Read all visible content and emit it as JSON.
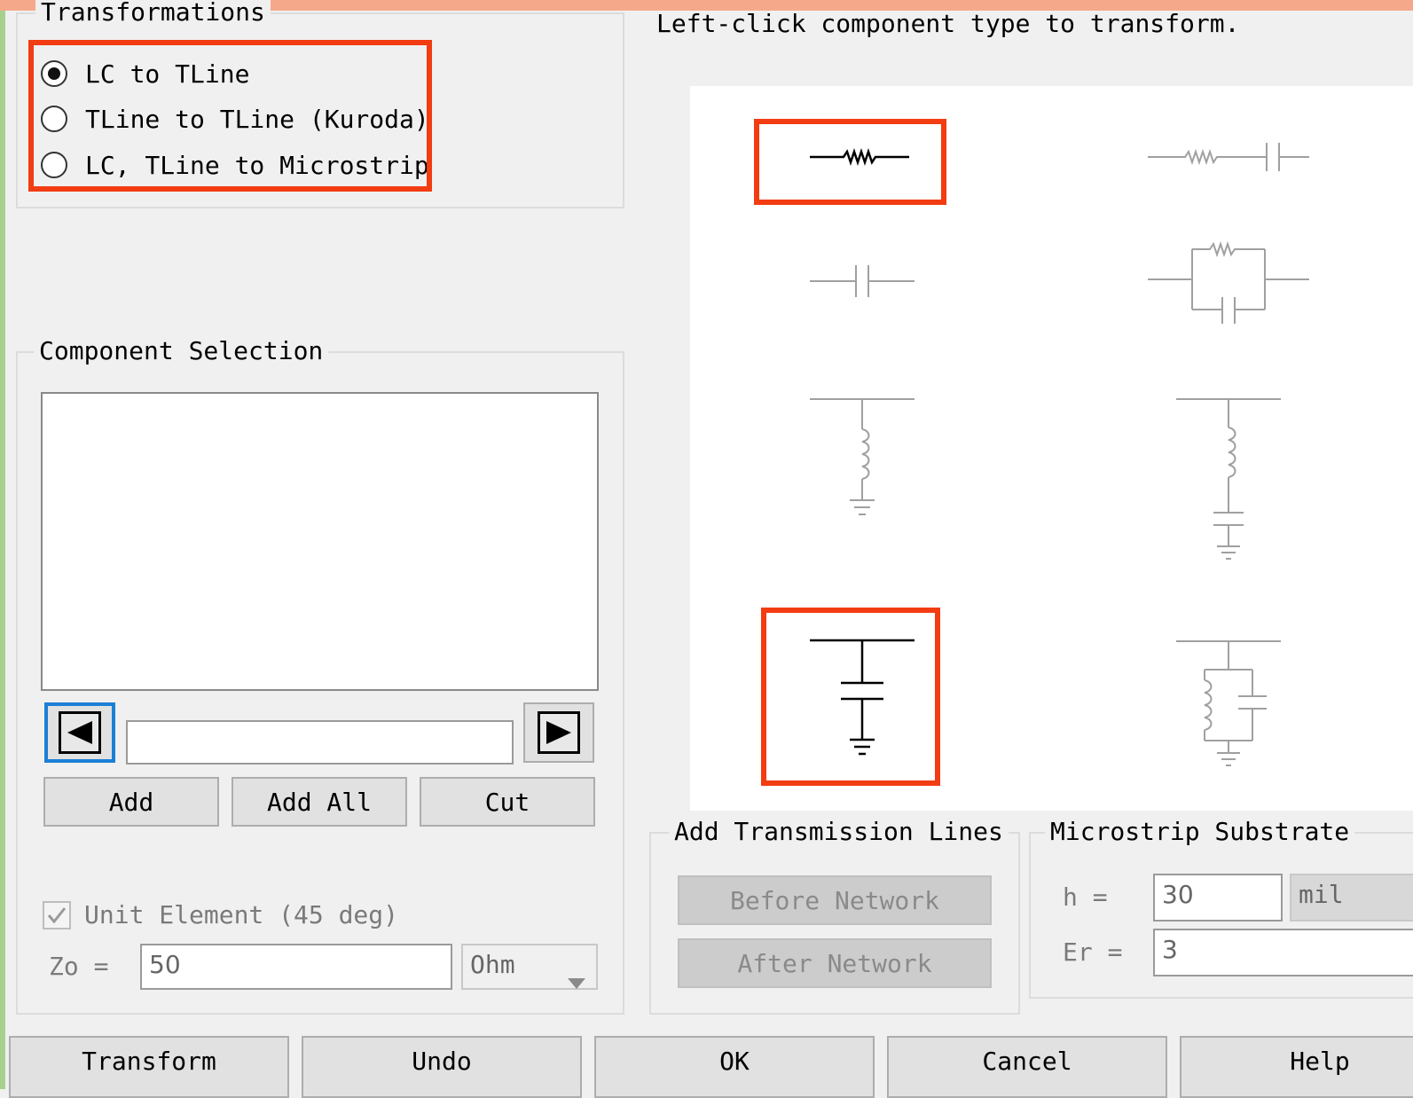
{
  "transformations": {
    "legend": "Transformations",
    "options": [
      {
        "label": "LC to TLine",
        "checked": true
      },
      {
        "label": "TLine to TLine (Kuroda)",
        "checked": false
      },
      {
        "label": "LC, TLine to Microstrip",
        "checked": false
      }
    ]
  },
  "instruction": "Left-click component type to transform.",
  "component_selection": {
    "legend": "Component Selection",
    "selected_value": "",
    "add_label": "Add",
    "add_all_label": "Add All",
    "cut_label": "Cut",
    "left_arrow_icon": "left-triangle-icon",
    "right_arrow_icon": "right-triangle-icon",
    "unit_element_label": "Unit Element (45 deg)",
    "unit_element_checked": true,
    "zo_label": "Zo =",
    "zo_value": "50",
    "zo_unit": "Ohm"
  },
  "component_types": [
    {
      "name": "series-inductor",
      "enabled": true,
      "highlighted": true
    },
    {
      "name": "series-inductor-capacitor",
      "enabled": false
    },
    {
      "name": "series-capacitor",
      "enabled": false
    },
    {
      "name": "series-parallel-lc",
      "enabled": false
    },
    {
      "name": "shunt-inductor",
      "enabled": false
    },
    {
      "name": "shunt-series-lc",
      "enabled": false
    },
    {
      "name": "shunt-capacitor",
      "enabled": true,
      "highlighted": true
    },
    {
      "name": "shunt-parallel-lc",
      "enabled": false
    }
  ],
  "add_tlines": {
    "legend": "Add Transmission Lines",
    "before_label": "Before Network",
    "after_label": "After Network"
  },
  "substrate": {
    "legend": "Microstrip Substrate",
    "h_label": "h =",
    "h_value": "30",
    "h_unit": "mil",
    "er_label": "Er =",
    "er_value": "3"
  },
  "buttons": {
    "transform": "Transform",
    "undo": "Undo",
    "ok": "OK",
    "cancel": "Cancel",
    "help": "Help"
  },
  "colors": {
    "highlight": "#f23c12",
    "focus": "#1c7fd6",
    "enabled_stroke": "#000000",
    "disabled_stroke": "#a0a0a0"
  }
}
